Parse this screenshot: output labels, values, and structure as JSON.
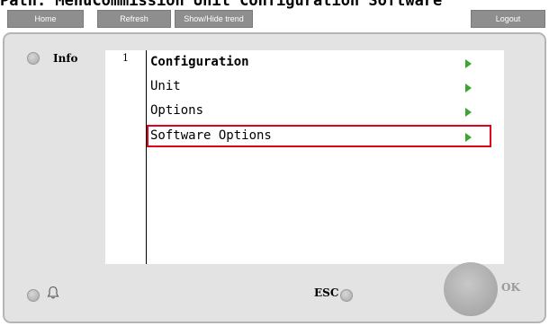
{
  "path_text": "Path: MenuCommission Unit Configuration Software",
  "toolbar": {
    "home": "Home",
    "refresh": "Refresh",
    "show_hide_trend": "Show/Hide trend",
    "logout": "Logout"
  },
  "panel": {
    "info_label": "Info",
    "line_number": "1",
    "menu": [
      {
        "label": "Configuration",
        "bold": true
      },
      {
        "label": "Unit",
        "bold": false
      },
      {
        "label": "Options",
        "bold": false
      },
      {
        "label": "Software Options",
        "bold": false,
        "highlighted": true
      }
    ],
    "esc_label": "ESC",
    "ok_label": "OK"
  },
  "colors": {
    "highlight_border": "#e3001b",
    "arrow": "#3aa630",
    "toolbar_button": "#8e8e8e",
    "panel_bg": "#e3e3e3"
  },
  "icons": [
    "info-led-icon",
    "bell-icon",
    "alarm-led-icon",
    "esc-led-icon",
    "menu-arrow-icon"
  ]
}
